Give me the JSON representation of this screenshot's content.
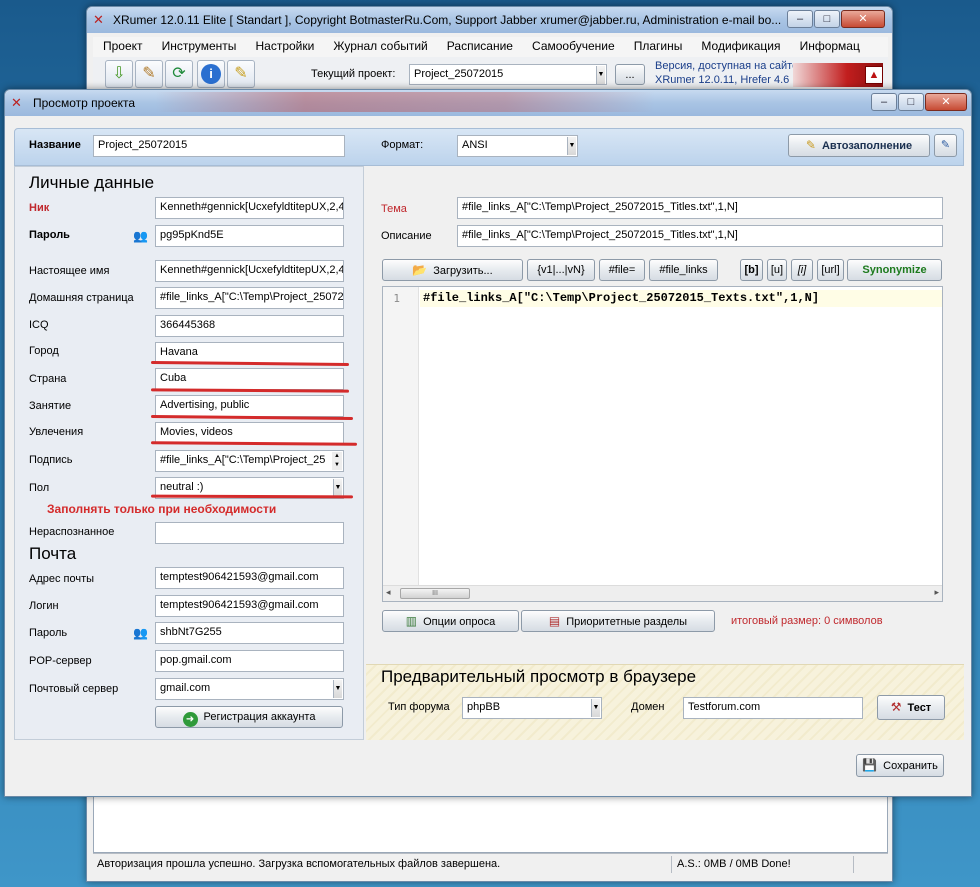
{
  "main_window": {
    "title": "XRumer 12.0.11 Elite [ Standart ], Copyright BotmasterRu.Com, Support Jabber xrumer@jabber.ru, Administration e-mail bo...",
    "menu": [
      "Проект",
      "Инструменты",
      "Настройки",
      "Журнал событий",
      "Расписание",
      "Самообучение",
      "Плагины",
      "Модификация",
      "Информац"
    ],
    "current_project_label": "Текущий проект:",
    "current_project": "Project_25072015",
    "browse_label": "...",
    "version_line1": "Версия, доступная на сайте:",
    "version_line2": "XRumer 12.0.11, Hrefer 4.6",
    "status_text": "Авторизация прошла успешно. Загрузка вспомогательных файлов завершена.",
    "status_size": "A.S.: 0MB / 0MB Done!"
  },
  "dialog": {
    "title": "Просмотр проекта",
    "name_label": "Название",
    "name_value": "Project_25072015",
    "format_label": "Формат:",
    "format_value": "ANSI",
    "autofill_label": "Автозаполнение",
    "personal_title": "Личные данные",
    "personal": {
      "nick_label": "Ник",
      "nick_value": "Kenneth#gennick[UcxefyldtitepUX,2,4",
      "password_label": "Пароль",
      "password_value": "pg95pKnd5E",
      "realname_label": "Настоящее имя",
      "realname_value": "Kenneth#gennick[UcxefyldtitepUX,2,4",
      "homepage_label": "Домашняя страница",
      "homepage_value": "#file_links_A[\"C:\\Temp\\Project_25072",
      "icq_label": "ICQ",
      "icq_value": "366445368",
      "city_label": "Город",
      "city_value": "Havana",
      "country_label": "Страна",
      "country_value": "Cuba",
      "occupation_label": "Занятие",
      "occupation_value": "Advertising, public",
      "hobbies_label": "Увлечения",
      "hobbies_value": "Movies, videos",
      "signature_label": "Подпись",
      "signature_value": "#file_links_A[\"C:\\Temp\\Project_25",
      "gender_label": "Пол",
      "gender_value": "neutral :)",
      "note": "Заполнять только при необходимости",
      "unrecognized_label": "Нераспознанное",
      "unrecognized_value": ""
    },
    "mail_title": "Почта",
    "mail": {
      "address_label": "Адрес почты",
      "address_value": "temptest906421593@gmail.com",
      "login_label": "Логин",
      "login_value": "temptest906421593@gmail.com",
      "password_label": "Пароль",
      "password_value": "shbNt7G255",
      "pop_label": "POP-сервер",
      "pop_value": "pop.gmail.com",
      "server_label": "Почтовый сервер",
      "server_value": "gmail.com",
      "register_label": "Регистрация аккаунта"
    },
    "message": {
      "subject_label": "Тема",
      "subject_value": "#file_links_A[\"C:\\Temp\\Project_25072015_Titles.txt\",1,N]",
      "description_label": "Описание",
      "description_value": "#file_links_A[\"C:\\Temp\\Project_25072015_Titles.txt\",1,N]",
      "load_label": "Загрузить...",
      "macro1": "{v1|...|vN}",
      "macro2": "#file=",
      "macro3": "#file_links",
      "bold": "[b]",
      "underline": "[u]",
      "italic": "[i]",
      "url": "[url]",
      "synonymize": "Synonymize",
      "line_number": "1",
      "body_text": "#file_links_A[\"C:\\Temp\\Project_25072015_Texts.txt\",1,N]",
      "scroll_thumb": "III",
      "poll_options": "Опции опроса",
      "priority_sections": "Приоритетные разделы",
      "total_size": "итоговый размер: 0 символов"
    },
    "preview": {
      "title": "Предварительный просмотр в браузере",
      "forum_type_label": "Тип форума",
      "forum_type_value": "phpBB",
      "domain_label": "Домен",
      "domain_value": "Testforum.com",
      "test_label": "Тест"
    },
    "save_label": "Сохранить"
  },
  "colors": {
    "required_label": "#c0282d",
    "note_red": "#d42b2b",
    "synonymize_green": "#1d7a1d",
    "left_panel": "#e9edf3",
    "header_band": "#c9dcf0",
    "preview_band": "#f7f2dc"
  },
  "icons": {
    "minimize": "minimize-icon",
    "maximize": "maximize-icon",
    "close": "close-icon",
    "pencil": "pencil-icon",
    "people": "people-icon",
    "go": "arrow-right-icon",
    "hammer": "hammer-icon",
    "folder": "folder-open-icon",
    "save": "save-icon"
  }
}
